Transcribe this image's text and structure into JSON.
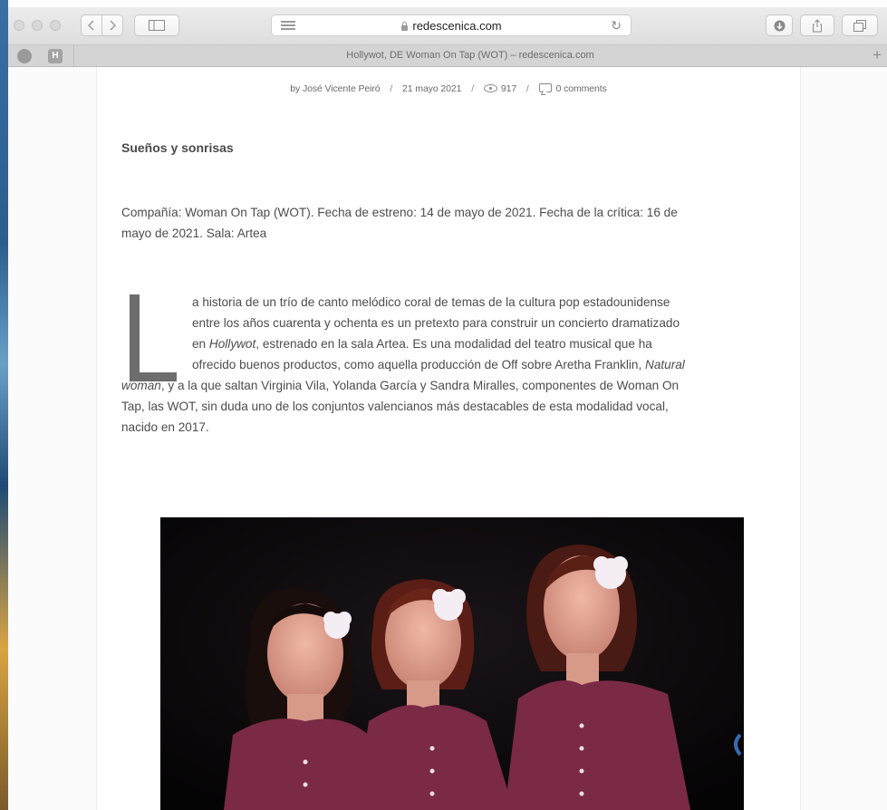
{
  "browser": {
    "address": "redescenica.com",
    "tab_title": "Hollywot, DE Woman On Tap (WOT) – redescenica.com",
    "new_tab_label": "+",
    "favorites": [
      "H"
    ]
  },
  "article": {
    "meta": {
      "author": "by José Vicente Peiró",
      "date": "21 mayo 2021",
      "views": "917",
      "comments": "0 comments"
    },
    "subtitle": "Sueños y sonrisas",
    "info_line1": "Compañía: Woman On Tap (WOT). Fecha de estreno: 14 de mayo de 2021. Fecha de la crítica: 16 de",
    "info_line2": "mayo de 2021. Sala: Artea",
    "dropcap_letter": "L",
    "body": {
      "line1": "a historia de un trío de canto melódico coral de temas de la cultura pop estadounidense",
      "line2": "entre los años cuarenta y ochenta es un pretexto para construir un concierto dramatizado",
      "line3_pre": "en ",
      "line3_em": "Hollywot",
      "line3_post": ", estrenado en la sala Artea. Es una modalidad del teatro musical que ha",
      "line4_pre": "ofrecido buenos productos, como aquella producción de Off sobre Aretha Franklin, ",
      "line4_em": "Natural",
      "line5_em": "woman",
      "line5_post": ", y a la que saltan Virginia Vila, Yolanda García y Sandra Miralles, componentes de Woman On",
      "line6": "Tap, las WOT, sin duda uno de los conjuntos valencianos más destacables de esta modalidad vocal,",
      "line7": "nacido en 2017."
    }
  },
  "colors": {
    "text": "#4d4d4d",
    "dress": "#7a2a45",
    "flower": "#f4eef4"
  }
}
